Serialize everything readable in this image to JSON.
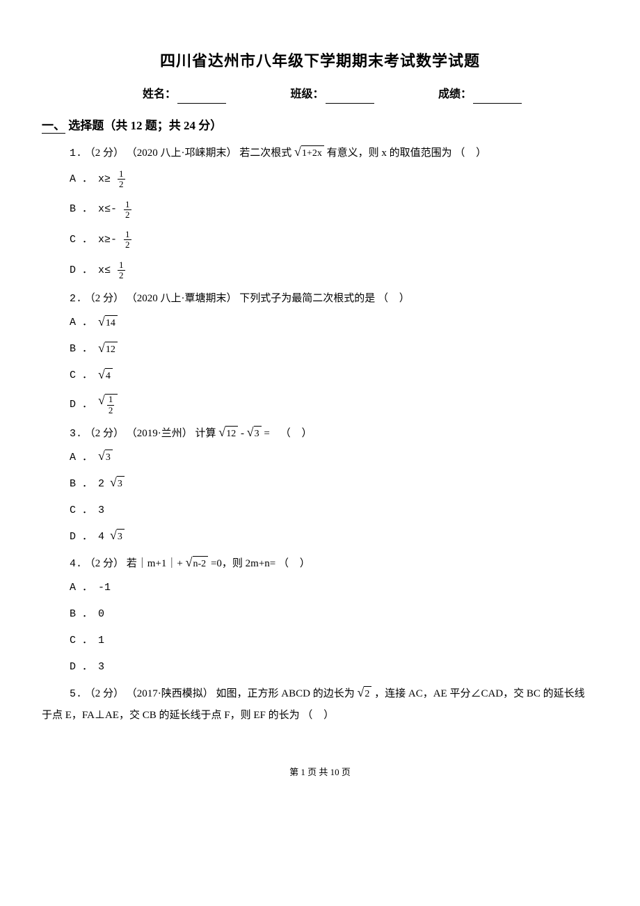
{
  "title": "四川省达州市八年级下学期期末考试数学试题",
  "info": {
    "name_label": "姓名：",
    "class_label": "班级：",
    "score_label": "成绩："
  },
  "section1": {
    "heading_prefix": "一、",
    "heading_text": "选择题（共 12 题；共 24 分）"
  },
  "q1": {
    "num": "1.",
    "points": "（2 分）",
    "source": "（2020 八上·邛崃期末）",
    "text_a": "若二次根式",
    "rad": "1+2x",
    "text_b": "有意义，则 x 的取值范围为",
    "paren": "（      ）",
    "optA_lbl": "A ．",
    "optA_pre": "x≥",
    "optB_lbl": "B ．",
    "optB_pre": "x≤-",
    "optC_lbl": "C ．",
    "optC_pre": "x≥-",
    "optD_lbl": "D ．",
    "optD_pre": "x≤",
    "frac_num": "1",
    "frac_den": "2"
  },
  "q2": {
    "num": "2.",
    "points": "（2 分）",
    "source": "（2020 八上·覃塘期末）",
    "text": "下列式子为最简二次根式的是",
    "paren": "（      ）",
    "optA_lbl": "A ．",
    "optA_rad": "14",
    "optB_lbl": "B ．",
    "optB_rad": "12",
    "optC_lbl": "C ．",
    "optC_rad": "4",
    "optD_lbl": "D ．",
    "optD_num": "1",
    "optD_den": "2"
  },
  "q3": {
    "num": "3.",
    "points": "（2 分）",
    "source": "（2019·兰州）",
    "text_a": "计算",
    "rad1": "12",
    "minus": "-",
    "rad2": "3",
    "eq": " =",
    "paren": "（      ）",
    "optA_lbl": "A ．",
    "optA_rad": "3",
    "optB_lbl": "B ．",
    "optB_pre": "2",
    "optB_rad": "3",
    "optC_lbl": "C ．",
    "optC_val": "3",
    "optD_lbl": "D ．",
    "optD_pre": "4",
    "optD_rad": "3"
  },
  "q4": {
    "num": "4.",
    "points": "（2 分）",
    "text_a": "若｜m+1｜+",
    "rad": "n-2",
    "text_b": "=0，则 2m+n=",
    "paren": "（      ）",
    "optA_lbl": "A ．",
    "optA_val": "-1",
    "optB_lbl": "B ．",
    "optB_val": "0",
    "optC_lbl": "C ．",
    "optC_val": "1",
    "optD_lbl": "D ．",
    "optD_val": "3"
  },
  "q5": {
    "num": "5.",
    "points": "（2 分）",
    "source": "（2017·陕西模拟）",
    "text_a": "如图，正方形 ABCD 的边长为",
    "rad": "2",
    "text_b": "，连接 AC，AE 平分∠CAD，交 BC 的延长线",
    "text_c": "于点 E，FA⊥AE，交 CB 的延长线于点 F，则 EF 的长为",
    "paren": "（      ）"
  },
  "footer": "第 1 页 共 10 页"
}
